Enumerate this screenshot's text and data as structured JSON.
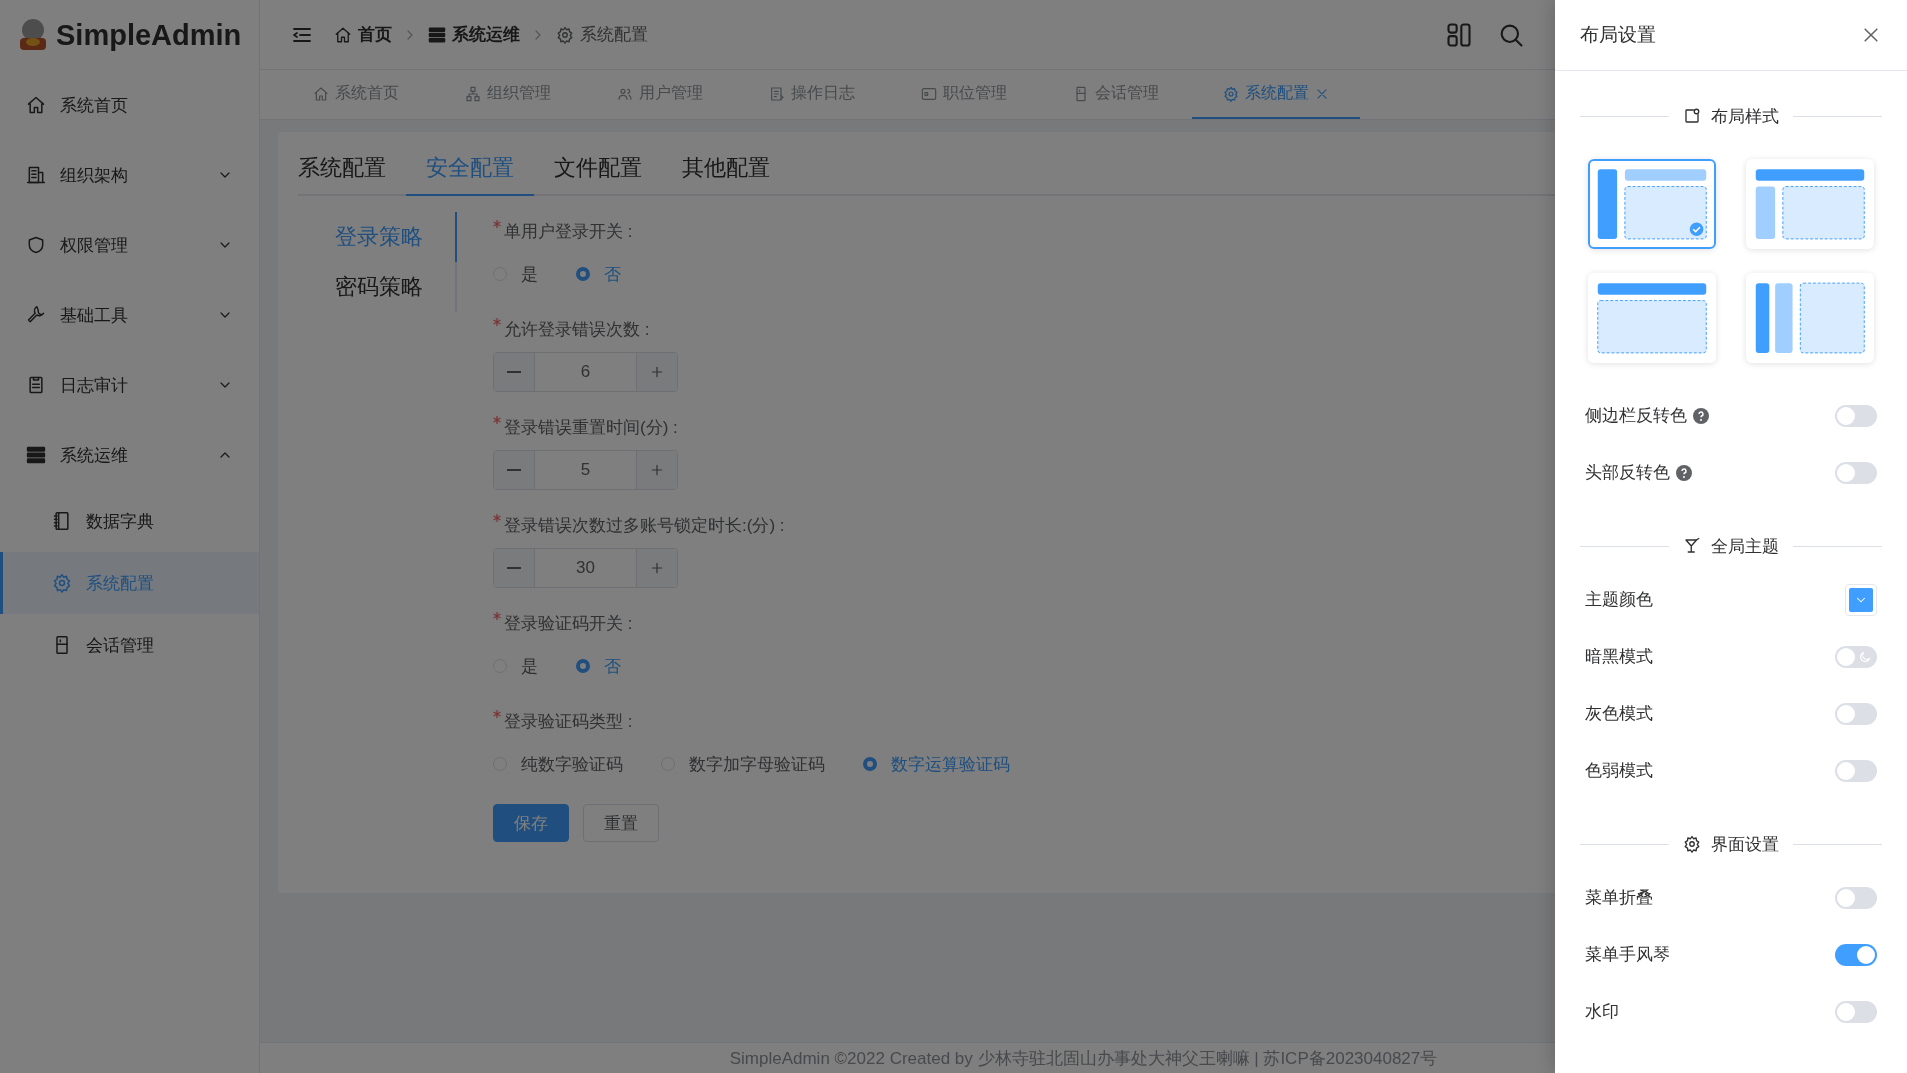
{
  "brand": {
    "name": "SimpleAdmin"
  },
  "sidebar": {
    "items": [
      {
        "kind": "link",
        "label": "系统首页",
        "selected": false
      },
      {
        "kind": "group",
        "label": "组织架构",
        "expanded": false,
        "selected": false
      },
      {
        "kind": "group",
        "label": "权限管理",
        "expanded": false,
        "selected": false
      },
      {
        "kind": "group",
        "label": "基础工具",
        "expanded": false,
        "selected": false
      },
      {
        "kind": "group",
        "label": "日志审计",
        "expanded": false,
        "selected": false
      },
      {
        "kind": "group",
        "label": "系统运维",
        "expanded": true,
        "selected": false,
        "children": [
          {
            "label": "数据字典",
            "selected": false
          },
          {
            "label": "系统配置",
            "selected": true
          },
          {
            "label": "会话管理",
            "selected": false
          }
        ]
      }
    ]
  },
  "breadcrumb": [
    {
      "label": "首页",
      "current": false
    },
    {
      "label": "系统运维",
      "current": false
    },
    {
      "label": "系统配置",
      "current": true
    }
  ],
  "tabs": [
    {
      "label": "系统首页",
      "selected": false
    },
    {
      "label": "组织管理",
      "selected": false
    },
    {
      "label": "用户管理",
      "selected": false
    },
    {
      "label": "操作日志",
      "selected": false
    },
    {
      "label": "职位管理",
      "selected": false
    },
    {
      "label": "会话管理",
      "selected": false
    },
    {
      "label": "系统配置",
      "selected": true
    }
  ],
  "config_tabs": [
    {
      "label": "系统配置",
      "selected": false
    },
    {
      "label": "安全配置",
      "selected": true
    },
    {
      "label": "文件配置",
      "selected": false
    },
    {
      "label": "其他配置",
      "selected": false
    }
  ],
  "security_form": {
    "side_nav": [
      {
        "label": "登录策略",
        "selected": true
      },
      {
        "label": "密码策略",
        "selected": false
      }
    ],
    "fields": [
      {
        "kind": "radio",
        "label": "单用户登录开关 :",
        "required": true,
        "options": [
          {
            "label": "是",
            "selected": false
          },
          {
            "label": "否",
            "selected": true
          }
        ]
      },
      {
        "kind": "number",
        "label": "允许登录错误次数 :",
        "required": true,
        "value": "6"
      },
      {
        "kind": "number",
        "label": "登录错误重置时间(分) :",
        "required": true,
        "value": "5"
      },
      {
        "kind": "number",
        "label": "登录错误次数过多账号锁定时长:(分) :",
        "required": true,
        "value": "30"
      },
      {
        "kind": "radio",
        "label": "登录验证码开关 :",
        "required": true,
        "options": [
          {
            "label": "是",
            "selected": false
          },
          {
            "label": "否",
            "selected": true
          }
        ]
      },
      {
        "kind": "radio",
        "label": "登录验证码类型 :",
        "required": true,
        "options": [
          {
            "label": "纯数字验证码",
            "selected": false
          },
          {
            "label": "数字加字母验证码",
            "selected": false
          },
          {
            "label": "数字运算验证码",
            "selected": true
          }
        ]
      }
    ],
    "buttons": [
      {
        "kind": "primary",
        "label": "保存"
      },
      {
        "kind": "default",
        "label": "重置"
      }
    ]
  },
  "footer": {
    "text": "SimpleAdmin ©2022 Created by 少林寺驻北固山办事处大神父王喇嘛 | 苏ICP备2023040827号"
  },
  "layout_drawer": {
    "title": "布局设置",
    "sections": [
      {
        "title": "布局样式",
        "layouts": [
          {
            "selected": true
          },
          {
            "selected": false
          },
          {
            "selected": false
          },
          {
            "selected": false
          }
        ],
        "items": [
          {
            "kind": "switch",
            "label": "侧边栏反转色",
            "help": true,
            "on": false
          },
          {
            "kind": "switch",
            "label": "头部反转色",
            "help": true,
            "on": false
          }
        ]
      },
      {
        "title": "全局主题",
        "items": [
          {
            "kind": "color",
            "label": "主题颜色",
            "color": "#409eff"
          },
          {
            "kind": "dark-switch",
            "label": "暗黑模式",
            "help": false,
            "on": false
          },
          {
            "kind": "switch",
            "label": "灰色模式",
            "help": false,
            "on": false
          },
          {
            "kind": "switch",
            "label": "色弱模式",
            "help": false,
            "on": false
          }
        ]
      },
      {
        "title": "界面设置",
        "items": [
          {
            "kind": "switch",
            "label": "菜单折叠",
            "help": false,
            "on": false
          },
          {
            "kind": "switch",
            "label": "菜单手风琴",
            "help": false,
            "on": true
          },
          {
            "kind": "switch",
            "label": "水印",
            "help": false,
            "on": false
          }
        ]
      }
    ]
  }
}
